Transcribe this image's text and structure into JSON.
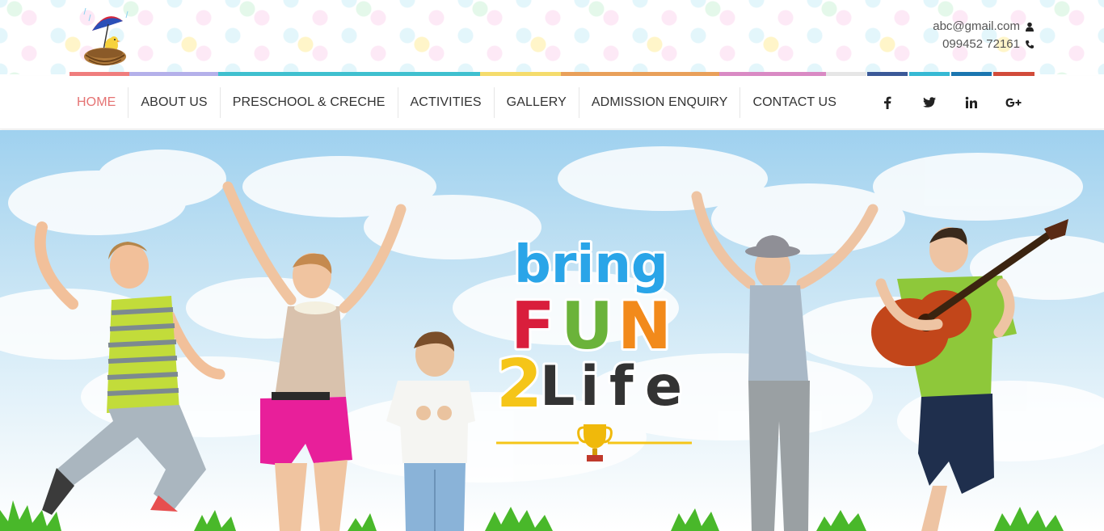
{
  "header": {
    "email": "abc@gmail.com",
    "phone": "099452 72161",
    "email_icon": "user-icon",
    "phone_icon": "phone-icon"
  },
  "stripe_colors": [
    "#f07d7d",
    "#b4b0ea",
    "#3fc0cf",
    "#f5dc6c",
    "#e9a05a",
    "#d98ac4",
    "#e6e6e6",
    "#3b5998",
    "#36b9d4",
    "#1b76b0",
    "#d24b3a"
  ],
  "nav": {
    "items": [
      {
        "label": "HOME",
        "active": true
      },
      {
        "label": "ABOUT US"
      },
      {
        "label": "PRESCHOOL & CRECHE"
      },
      {
        "label": "ACTIVITIES"
      },
      {
        "label": "GALLERY"
      },
      {
        "label": "ADMISSION ENQUIRY"
      },
      {
        "label": "CONTACT US"
      }
    ],
    "social": [
      {
        "label": "f",
        "icon": "facebook-icon"
      },
      {
        "label": "🐦",
        "icon": "twitter-icon"
      },
      {
        "label": "in",
        "icon": "linkedin-icon"
      },
      {
        "label": "G+",
        "icon": "google-plus-icon"
      }
    ]
  },
  "hero": {
    "line1": "bring",
    "line2": [
      "F",
      "U",
      "N"
    ],
    "line3": [
      "2",
      "L",
      "i",
      "f",
      "e"
    ],
    "colors": {
      "line1": "#2aa5e8",
      "F": "#d91e3c",
      "U": "#6bb33a",
      "N": "#f28a1b",
      "2": "#f5c518",
      "L": "#333333",
      "i": "#333333",
      "f": "#333333",
      "e": "#333333"
    },
    "trophy_color": "#f0b90b"
  }
}
